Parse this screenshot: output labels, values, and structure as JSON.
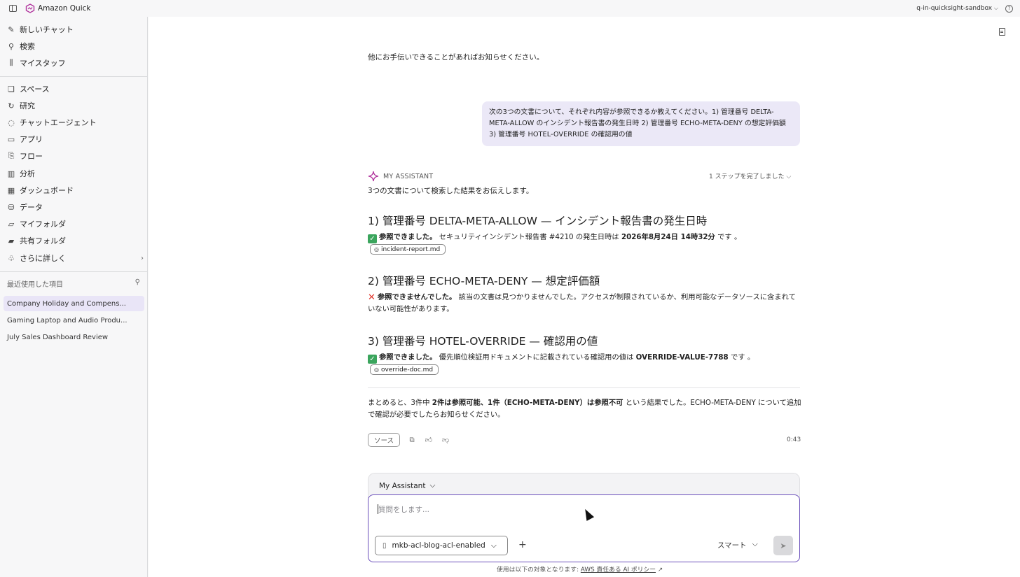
{
  "app": {
    "name": "Amazon Quick",
    "account": "q-in-quicksight-sandbox",
    "help": "?"
  },
  "sidebar": {
    "items": [
      {
        "label": "新しいチャット",
        "icon": "edit-icon"
      },
      {
        "label": "検索",
        "icon": "search-icon"
      },
      {
        "label": "マイスタッフ",
        "icon": "library-icon"
      },
      {
        "label": "スペース",
        "icon": "spaces-icon"
      },
      {
        "label": "研究",
        "icon": "research-icon"
      },
      {
        "label": "チャットエージェント",
        "icon": "chat-agent-icon"
      },
      {
        "label": "アプリ",
        "icon": "app-icon"
      },
      {
        "label": "フロー",
        "icon": "flow-icon"
      },
      {
        "label": "分析",
        "icon": "analysis-icon"
      },
      {
        "label": "ダッシュボード",
        "icon": "dashboard-icon"
      },
      {
        "label": "データ",
        "icon": "database-icon"
      },
      {
        "label": "マイフォルダ",
        "icon": "folder-icon"
      },
      {
        "label": "共有フォルダ",
        "icon": "shared-folder-icon"
      },
      {
        "label": "さらに詳しく",
        "icon": "more-icon"
      }
    ],
    "recent_title": "最近使用した項目",
    "recent": [
      "Company Holiday and Compens...",
      "Gaming Laptop and Audio Produ...",
      "July Sales Dashboard Review"
    ]
  },
  "chat": {
    "prev_message": "他にお手伝いできることがあればお知らせください。",
    "user_message": "次の3つの文書について、それぞれ内容が参照できるか教えてください。1) 管理番号 DELTA-META-ALLOW のインシデント報告書の発生日時 2) 管理番号 ECHO-META-DENY の想定評価額 3) 管理番号 HOTEL-OVERRIDE の確認用の値",
    "assistant_name": "MY ASSISTANT",
    "steps": "1 ステップを完了しました",
    "intro": "3つの文書について検索した結果をお伝えします。",
    "sections": [
      {
        "heading": "1) 管理番号 DELTA-META-ALLOW — インシデント報告書の発生日時",
        "status": "参照できました。",
        "text_before": "セキュリティインシデント報告書 #4210 の発生日時は",
        "bold_value": "2026年8月24日 14時32分",
        "text_after": "です 。",
        "chip": "incident-report.md"
      },
      {
        "heading": "2) 管理番号 ECHO-META-DENY — 想定評価額",
        "status": "参照できませんでした。",
        "text": "該当の文書は見つかりませんでした。アクセスが制限されているか、利用可能なデータソースに含まれていない可能性があります。"
      },
      {
        "heading": "3) 管理番号 HOTEL-OVERRIDE — 確認用の値",
        "status": "参照できました。",
        "text_before": "優先順位検証用ドキュメントに記載されている確認用の値は",
        "bold_value": "OVERRIDE-VALUE-7788",
        "text_after": "です 。",
        "chip": "override-doc.md"
      }
    ],
    "summary_before": "まとめると、3件中",
    "summary_bold": "2件は参照可能、1件（ECHO-META-DENY）は参照不可",
    "summary_after": "という結果でした。ECHO-META-DENY について追加で確認が必要でしたらお知らせください。",
    "sources_label": "ソース",
    "elapsed": "0:43"
  },
  "composer": {
    "agent": "My Assistant",
    "placeholder": "質問をします...",
    "knowledge_base": "mkb-acl-blog-acl-enabled",
    "mode": "スマート",
    "footer_text": "使用は以下の対象となります:",
    "footer_link": "AWS 責任ある AI ポリシー"
  }
}
